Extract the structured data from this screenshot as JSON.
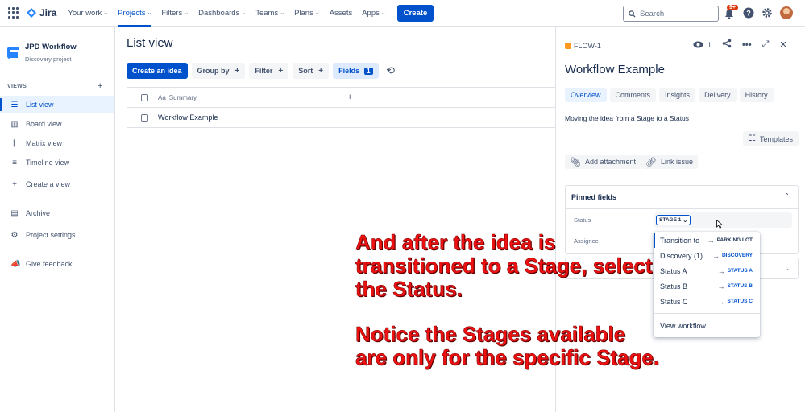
{
  "topnav": {
    "brand": "Jira",
    "items": [
      {
        "label": "Your work",
        "has_chevron": true
      },
      {
        "label": "Projects",
        "has_chevron": true,
        "active": true
      },
      {
        "label": "Filters",
        "has_chevron": true
      },
      {
        "label": "Dashboards",
        "has_chevron": true
      },
      {
        "label": "Teams",
        "has_chevron": true
      },
      {
        "label": "Plans",
        "has_chevron": true
      },
      {
        "label": "Assets",
        "has_chevron": false
      },
      {
        "label": "Apps",
        "has_chevron": true
      }
    ],
    "create_label": "Create",
    "search_placeholder": "Search",
    "notifications_badge": "9+"
  },
  "sidebar": {
    "project_name": "JPD Workflow",
    "project_type": "Discovery project",
    "views_heading": "VIEWS",
    "views": [
      {
        "label": "List view",
        "icon": "list-icon",
        "active": true
      },
      {
        "label": "Board view",
        "icon": "board-icon",
        "active": false
      },
      {
        "label": "Matrix view",
        "icon": "matrix-icon",
        "active": false
      },
      {
        "label": "Timeline view",
        "icon": "timeline-icon",
        "active": false
      }
    ],
    "create_view_label": "Create a view",
    "archive_label": "Archive",
    "settings_label": "Project settings",
    "feedback_label": "Give feedback"
  },
  "main": {
    "title": "List view",
    "toolbar": {
      "create_idea_label": "Create an idea",
      "group_by_label": "Group by",
      "filter_label": "Filter",
      "sort_label": "Sort",
      "fields_label": "Fields",
      "fields_count": "1"
    },
    "table": {
      "header_prefix": "Aa",
      "header_label": "Summary",
      "rows": [
        {
          "summary": "Workflow Example"
        }
      ]
    }
  },
  "panel": {
    "issue_key": "FLOW-1",
    "watchers_count": "1",
    "title": "Workflow Example",
    "tabs": [
      {
        "label": "Overview",
        "active": true
      },
      {
        "label": "Comments",
        "active": false
      },
      {
        "label": "Insights",
        "active": false
      },
      {
        "label": "Delivery",
        "active": false
      },
      {
        "label": "History",
        "active": false
      }
    ],
    "description": "Moving the idea from a Stage to a Status",
    "templates_label": "Templates",
    "add_attachment_label": "Add attachment",
    "link_issue_label": "Link issue",
    "pinned_fields_heading": "Pinned fields",
    "status_label": "Status",
    "assignee_label": "Assignee",
    "status_value": "STAGE 1"
  },
  "status_dropdown": {
    "items": [
      {
        "label": "Transition to",
        "target": "PARKING LOT",
        "target_color": "#172b4d"
      },
      {
        "label": "Discovery (1)",
        "target": "DISCOVERY",
        "target_color": "#0052cc"
      },
      {
        "label": "Status A",
        "target": "STATUS A",
        "target_color": "#0052cc"
      },
      {
        "label": "Status B",
        "target": "STATUS B",
        "target_color": "#0052cc"
      },
      {
        "label": "Status C",
        "target": "STATUS C",
        "target_color": "#0052cc"
      }
    ],
    "view_workflow_label": "View workflow"
  },
  "annotation": {
    "lines_1": [
      "And after the idea is",
      "transitioned to a Stage, select",
      "the Status."
    ],
    "lines_2": [
      "Notice the Stages available",
      "are only for the specific Stage."
    ],
    "color": "#ee1111"
  },
  "colors": {
    "brand_blue": "#0052cc",
    "text": "#172b4d",
    "subtle": "#42526e",
    "badge_red": "#de350b"
  }
}
